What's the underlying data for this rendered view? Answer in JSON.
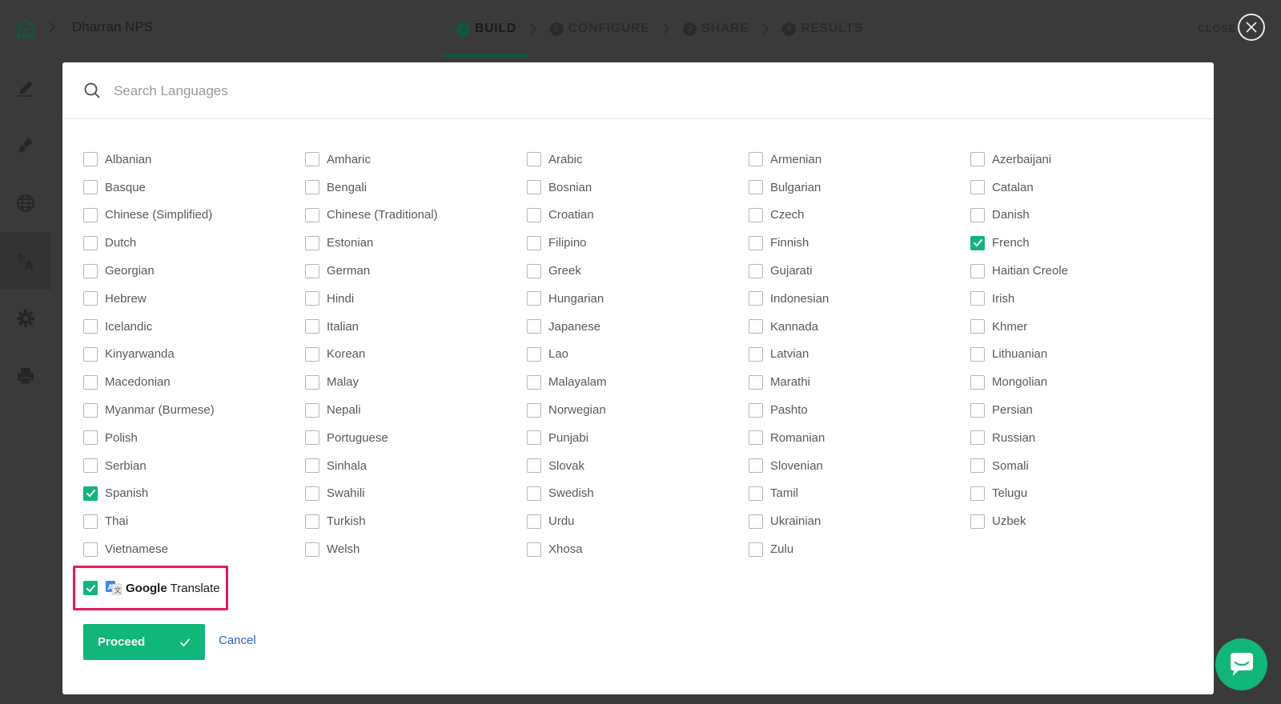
{
  "header": {
    "project_title": "Dharran NPS",
    "steps": [
      {
        "label": "BUILD",
        "icon": "check"
      },
      {
        "label": "CONFIGURE",
        "number": "2"
      },
      {
        "label": "SHARE",
        "number": "3"
      },
      {
        "label": "RESULTS",
        "number": "4"
      }
    ],
    "close_label": "CLOSE"
  },
  "sidebar": {
    "items": [
      {
        "icon": "pencil-icon"
      },
      {
        "icon": "paint-brush-icon"
      },
      {
        "icon": "globe-icon"
      },
      {
        "icon": "translate-icon",
        "active": true
      },
      {
        "icon": "gear-icon"
      },
      {
        "icon": "printer-icon"
      }
    ]
  },
  "search": {
    "placeholder": "Search Languages",
    "value": ""
  },
  "languages": [
    {
      "label": "Albanian",
      "checked": false
    },
    {
      "label": "Amharic",
      "checked": false
    },
    {
      "label": "Arabic",
      "checked": false
    },
    {
      "label": "Armenian",
      "checked": false
    },
    {
      "label": "Azerbaijani",
      "checked": false
    },
    {
      "label": "Basque",
      "checked": false
    },
    {
      "label": "Bengali",
      "checked": false
    },
    {
      "label": "Bosnian",
      "checked": false
    },
    {
      "label": "Bulgarian",
      "checked": false
    },
    {
      "label": "Catalan",
      "checked": false
    },
    {
      "label": "Chinese (Simplified)",
      "checked": false
    },
    {
      "label": "Chinese (Traditional)",
      "checked": false
    },
    {
      "label": "Croatian",
      "checked": false
    },
    {
      "label": "Czech",
      "checked": false
    },
    {
      "label": "Danish",
      "checked": false
    },
    {
      "label": "Dutch",
      "checked": false
    },
    {
      "label": "Estonian",
      "checked": false
    },
    {
      "label": "Filipino",
      "checked": false
    },
    {
      "label": "Finnish",
      "checked": false
    },
    {
      "label": "French",
      "checked": true
    },
    {
      "label": "Georgian",
      "checked": false
    },
    {
      "label": "German",
      "checked": false
    },
    {
      "label": "Greek",
      "checked": false
    },
    {
      "label": "Gujarati",
      "checked": false
    },
    {
      "label": "Haitian Creole",
      "checked": false
    },
    {
      "label": "Hebrew",
      "checked": false
    },
    {
      "label": "Hindi",
      "checked": false
    },
    {
      "label": "Hungarian",
      "checked": false
    },
    {
      "label": "Indonesian",
      "checked": false
    },
    {
      "label": "Irish",
      "checked": false
    },
    {
      "label": "Icelandic",
      "checked": false
    },
    {
      "label": "Italian",
      "checked": false
    },
    {
      "label": "Japanese",
      "checked": false
    },
    {
      "label": "Kannada",
      "checked": false
    },
    {
      "label": "Khmer",
      "checked": false
    },
    {
      "label": "Kinyarwanda",
      "checked": false
    },
    {
      "label": "Korean",
      "checked": false
    },
    {
      "label": "Lao",
      "checked": false
    },
    {
      "label": "Latvian",
      "checked": false
    },
    {
      "label": "Lithuanian",
      "checked": false
    },
    {
      "label": "Macedonian",
      "checked": false
    },
    {
      "label": "Malay",
      "checked": false
    },
    {
      "label": "Malayalam",
      "checked": false
    },
    {
      "label": "Marathi",
      "checked": false
    },
    {
      "label": "Mongolian",
      "checked": false
    },
    {
      "label": "Myanmar (Burmese)",
      "checked": false
    },
    {
      "label": "Nepali",
      "checked": false
    },
    {
      "label": "Norwegian",
      "checked": false
    },
    {
      "label": "Pashto",
      "checked": false
    },
    {
      "label": "Persian",
      "checked": false
    },
    {
      "label": "Polish",
      "checked": false
    },
    {
      "label": "Portuguese",
      "checked": false
    },
    {
      "label": "Punjabi",
      "checked": false
    },
    {
      "label": "Romanian",
      "checked": false
    },
    {
      "label": "Russian",
      "checked": false
    },
    {
      "label": "Serbian",
      "checked": false
    },
    {
      "label": "Sinhala",
      "checked": false
    },
    {
      "label": "Slovak",
      "checked": false
    },
    {
      "label": "Slovenian",
      "checked": false
    },
    {
      "label": "Somali",
      "checked": false
    },
    {
      "label": "Spanish",
      "checked": true
    },
    {
      "label": "Swahili",
      "checked": false
    },
    {
      "label": "Swedish",
      "checked": false
    },
    {
      "label": "Tamil",
      "checked": false
    },
    {
      "label": "Telugu",
      "checked": false
    },
    {
      "label": "Thai",
      "checked": false
    },
    {
      "label": "Turkish",
      "checked": false
    },
    {
      "label": "Urdu",
      "checked": false
    },
    {
      "label": "Ukrainian",
      "checked": false
    },
    {
      "label": "Uzbek",
      "checked": false
    },
    {
      "label": "Vietnamese",
      "checked": false
    },
    {
      "label": "Welsh",
      "checked": false
    },
    {
      "label": "Xhosa",
      "checked": false
    },
    {
      "label": "Zulu",
      "checked": false
    }
  ],
  "google_translate": {
    "checked": true,
    "brand": "Google",
    "label": "Translate"
  },
  "actions": {
    "proceed_label": "Proceed",
    "cancel_label": "Cancel"
  },
  "colors": {
    "accent": "#10b67a",
    "highlight": "#e8175d",
    "link": "#2367c8"
  }
}
